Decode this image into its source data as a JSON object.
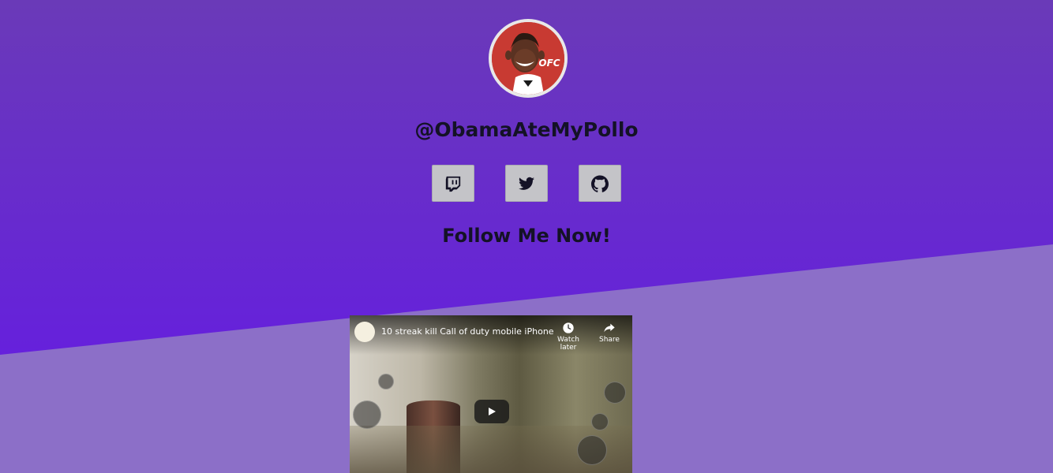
{
  "profile": {
    "handle": "@ObamaAteMyPollo",
    "avatar_icon": "profile-avatar",
    "avatar_text": "OFC"
  },
  "socials": [
    {
      "name": "twitch",
      "icon": "twitch-icon"
    },
    {
      "name": "twitter",
      "icon": "twitter-icon"
    },
    {
      "name": "github",
      "icon": "github-icon"
    }
  ],
  "cta": {
    "text": "Follow Me Now!"
  },
  "video": {
    "title": "10 streak kill Call of duty mobile iPhone",
    "watch_later_label": "Watch later",
    "share_label": "Share"
  },
  "colors": {
    "top_gradient_start": "#6a3ab8",
    "top_gradient_end": "#6418e8",
    "bottom_background": "#8c6fc8",
    "button_bg": "#c4c4c8",
    "text_dark": "#141226"
  }
}
